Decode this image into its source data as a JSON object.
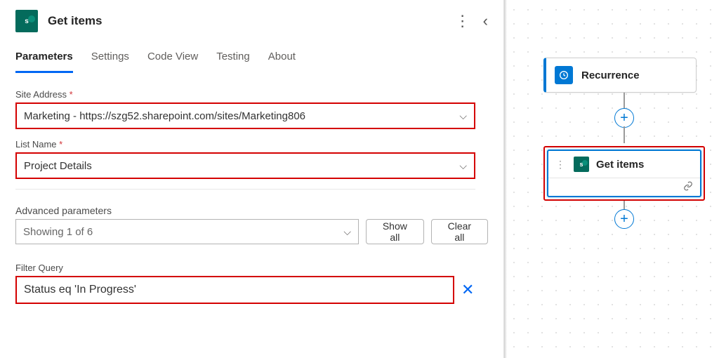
{
  "header": {
    "title": "Get items",
    "icon_letter": "s"
  },
  "tabs": [
    {
      "label": "Parameters",
      "active": true
    },
    {
      "label": "Settings",
      "active": false
    },
    {
      "label": "Code View",
      "active": false
    },
    {
      "label": "Testing",
      "active": false
    },
    {
      "label": "About",
      "active": false
    }
  ],
  "fields": {
    "site_address": {
      "label": "Site Address",
      "required_mark": "*",
      "value": "Marketing - https://szg52.sharepoint.com/sites/Marketing806"
    },
    "list_name": {
      "label": "List Name",
      "required_mark": "*",
      "value": "Project Details"
    }
  },
  "advanced": {
    "label": "Advanced parameters",
    "showing": "Showing 1 of 6",
    "show_all": "Show all",
    "clear_all": "Clear all"
  },
  "filter": {
    "label": "Filter Query",
    "value": "Status eq 'In Progress'"
  },
  "canvas": {
    "recurrence": {
      "label": "Recurrence"
    },
    "get_items": {
      "label": "Get items",
      "icon_letter": "s"
    }
  }
}
